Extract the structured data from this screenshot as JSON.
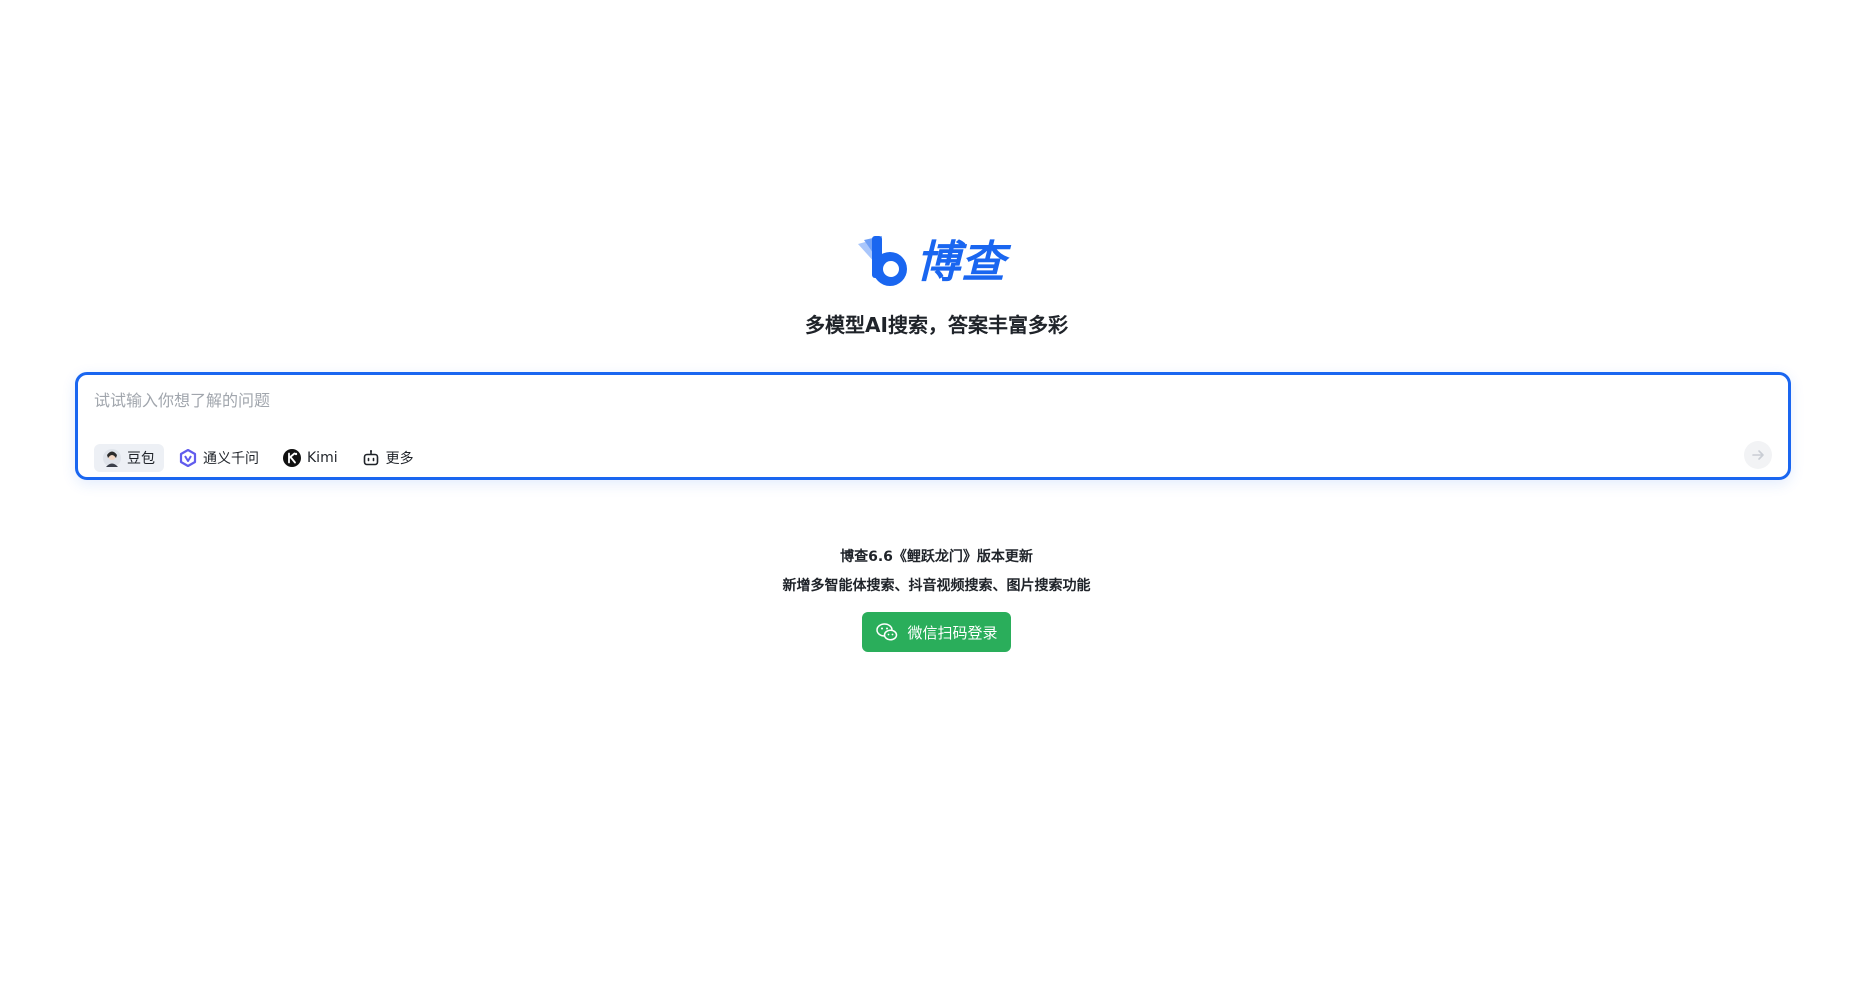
{
  "logo": {
    "brand_text": "博查",
    "accent_color": "#1a66f0"
  },
  "tagline": "多模型AI搜索，答案丰富多彩",
  "search": {
    "placeholder": "试试输入你想了解的问题",
    "value": ""
  },
  "models": [
    {
      "label": "豆包",
      "icon": "doubao-avatar-icon",
      "selected": true
    },
    {
      "label": "通义千问",
      "icon": "tongyi-qianwen-icon",
      "selected": false
    },
    {
      "label": "Kimi",
      "icon": "kimi-icon",
      "selected": false
    },
    {
      "label": "更多",
      "icon": "robot-icon",
      "selected": false
    }
  ],
  "send_icon": "arrow-right-icon",
  "update": {
    "title": "博查6.6《鲤跃龙门》版本更新",
    "description": "新增多智能体搜索、抖音视频搜索、图片搜索功能"
  },
  "login": {
    "label": "微信扫码登录",
    "icon": "wechat-icon",
    "color": "#2aae5b"
  }
}
